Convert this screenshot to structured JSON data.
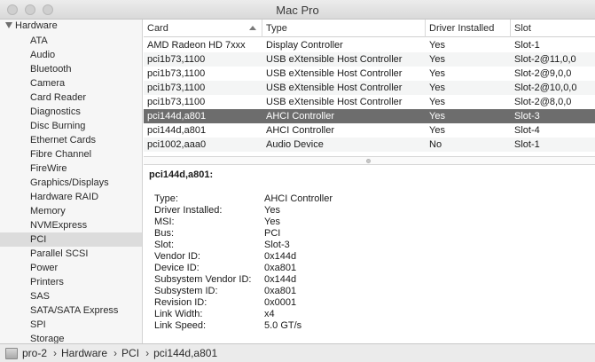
{
  "window": {
    "title": "Mac Pro"
  },
  "sidebar": {
    "header": "Hardware",
    "items": [
      "ATA",
      "Audio",
      "Bluetooth",
      "Camera",
      "Card Reader",
      "Diagnostics",
      "Disc Burning",
      "Ethernet Cards",
      "Fibre Channel",
      "FireWire",
      "Graphics/Displays",
      "Hardware RAID",
      "Memory",
      "NVMExpress",
      "PCI",
      "Parallel SCSI",
      "Power",
      "Printers",
      "SAS",
      "SATA/SATA Express",
      "SPI",
      "Storage"
    ],
    "selected": "PCI"
  },
  "table": {
    "columns": [
      "Card",
      "Type",
      "Driver Installed",
      "Slot"
    ],
    "sorted_column": "Card",
    "rows": [
      [
        "AMD Radeon HD 7xxx",
        "Display Controller",
        "Yes",
        "Slot-1"
      ],
      [
        "pci1b73,1100",
        "USB eXtensible Host Controller",
        "Yes",
        "Slot-2@11,0,0"
      ],
      [
        "pci1b73,1100",
        "USB eXtensible Host Controller",
        "Yes",
        "Slot-2@9,0,0"
      ],
      [
        "pci1b73,1100",
        "USB eXtensible Host Controller",
        "Yes",
        "Slot-2@10,0,0"
      ],
      [
        "pci1b73,1100",
        "USB eXtensible Host Controller",
        "Yes",
        "Slot-2@8,0,0"
      ],
      [
        "pci144d,a801",
        "AHCI Controller",
        "Yes",
        "Slot-3"
      ],
      [
        "pci144d,a801",
        "AHCI Controller",
        "Yes",
        "Slot-4"
      ],
      [
        "pci1002,aaa0",
        "Audio Device",
        "No",
        "Slot-1"
      ]
    ],
    "selected_row": 5
  },
  "detail": {
    "title": "pci144d,a801:",
    "fields": [
      {
        "key": "Type:",
        "value": "AHCI Controller"
      },
      {
        "key": "Driver Installed:",
        "value": "Yes"
      },
      {
        "key": "MSI:",
        "value": "Yes"
      },
      {
        "key": "Bus:",
        "value": "PCI"
      },
      {
        "key": "Slot:",
        "value": "Slot-3"
      },
      {
        "key": "Vendor ID:",
        "value": "0x144d"
      },
      {
        "key": "Device ID:",
        "value": "0xa801"
      },
      {
        "key": "Subsystem Vendor ID:",
        "value": "0x144d"
      },
      {
        "key": "Subsystem ID:",
        "value": "0xa801"
      },
      {
        "key": "Revision ID:",
        "value": "0x0001"
      },
      {
        "key": "Link Width:",
        "value": "x4"
      },
      {
        "key": "Link Speed:",
        "value": "5.0 GT/s"
      }
    ]
  },
  "pathbar": {
    "crumbs": [
      "pro-2",
      "Hardware",
      "PCI",
      "pci144d,a801"
    ],
    "separator": "›"
  },
  "colors": {
    "selected_row": "#6d6d6d",
    "sidebar_selected": "#dcdcdc",
    "alt_row": "#f4f5f5"
  }
}
